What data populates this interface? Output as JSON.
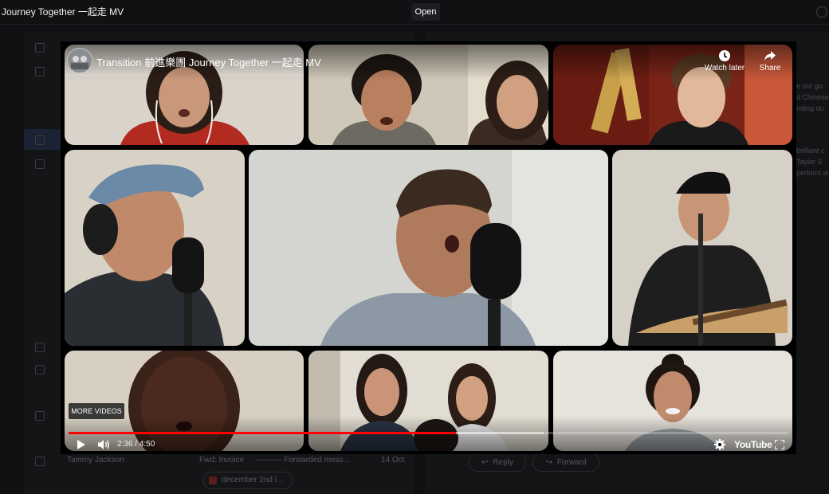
{
  "topbar": {
    "page_title": "Journey Together 一起走 MV",
    "open_label": "Open"
  },
  "mail": {
    "bottom_row": {
      "sender": "Tammy Jackson",
      "subject": "Fwd: Invoice",
      "snippet": "---------- Forwarded mess...",
      "date": "14 Oct"
    },
    "attachment_label": "december 2nd i...",
    "reply_label": "Reply",
    "forward_label": "Forward",
    "reading_fragments": [
      "e our gu",
      "d Chinese",
      "nding du",
      "brilliant c",
      "Taylor S",
      "perform w"
    ]
  },
  "video": {
    "title": "Transition 前進樂團 Journey Together 一起走 MV",
    "watch_later_label": "Watch later",
    "share_label": "Share",
    "more_videos_label": "MORE VIDEOS",
    "current_time": "2:36",
    "duration": "4:50",
    "time_separator": " / ",
    "played_fraction": 0.538,
    "buffered_fraction": 0.66,
    "logo_text": "YouTube",
    "accent_color": "#ff0000"
  }
}
